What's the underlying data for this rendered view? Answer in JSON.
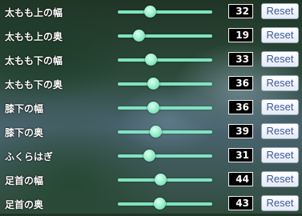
{
  "reset_label": "Reset",
  "slider_range": [
    0,
    100
  ],
  "colors": {
    "track": "#7fe3c0",
    "knob": "#9ff0cf",
    "value_bg": "#000000",
    "reset_text": "#3b5aa0"
  },
  "rows": [
    {
      "label": "太もも上の幅",
      "value": 32,
      "display": "32"
    },
    {
      "label": "太もも上の奥",
      "value": 19,
      "display": "19"
    },
    {
      "label": "太もも下の幅",
      "value": 33,
      "display": "33"
    },
    {
      "label": "太もも下の奥",
      "value": 36,
      "display": "36"
    },
    {
      "label": "膝下の幅",
      "value": 36,
      "display": "36"
    },
    {
      "label": "膝下の奥",
      "value": 39,
      "display": "39"
    },
    {
      "label": "ふくらはぎ",
      "value": 31,
      "display": "31"
    },
    {
      "label": "足首の幅",
      "value": 44,
      "display": "44"
    },
    {
      "label": "足首の奥",
      "value": 43,
      "display": "43"
    }
  ]
}
